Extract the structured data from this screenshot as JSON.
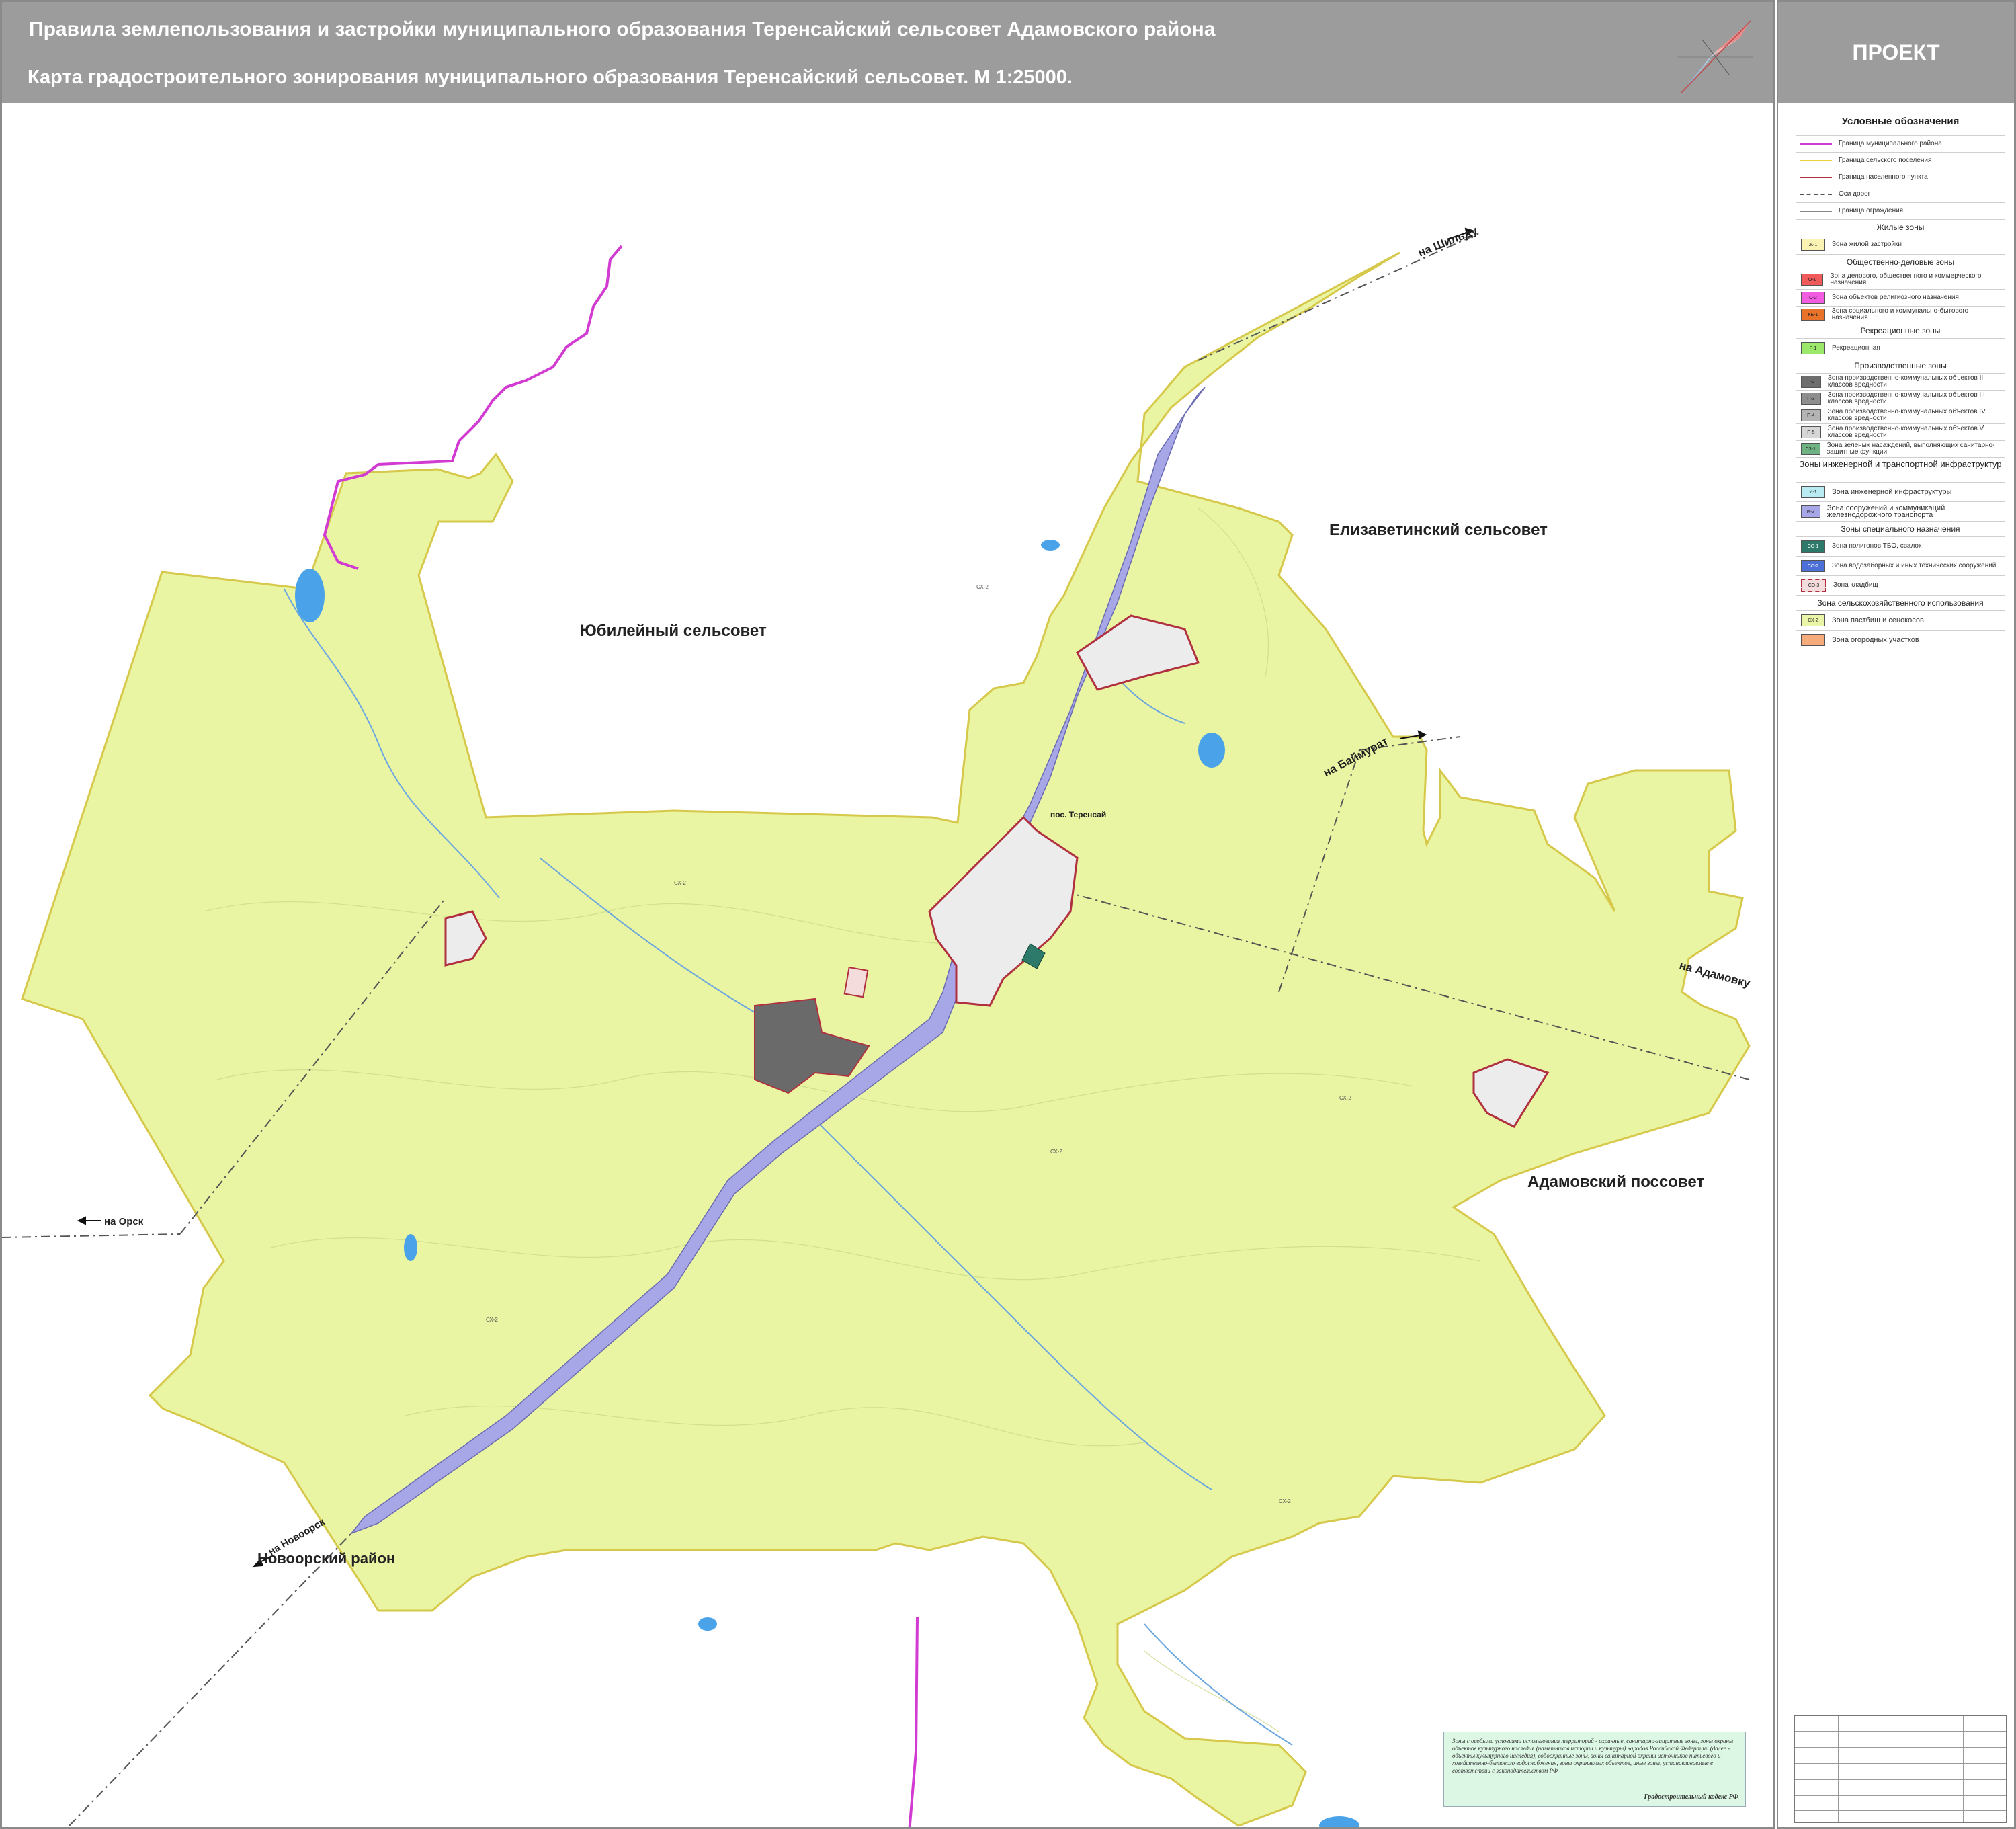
{
  "header": {
    "title_line1": "Правила землепользования и застройки муниципального образования Теренсайский сельсовет Адамовского района",
    "title_line2": "Карта градостроительного зонирования муниципального образования  Теренсайский сельсовет. М 1:25000.",
    "status": "ПРОЕКТ"
  },
  "map": {
    "neighbors": {
      "yubileyny": "Юбилейный сельсовет",
      "elizavetinsky": "Елизаветинский сельсовет",
      "adamovsky": "Адамовский поссовет",
      "novoorsky": "Новоорский район"
    },
    "roads": {
      "to_shildy": "на Шильду",
      "to_baimurat": "на Баймурат",
      "to_adamovka": "на Адамовку",
      "to_orsk": "на Орск",
      "to_novoorsk": "на Новоорск"
    },
    "settlement": "пос. Теренсай",
    "zone_label": "СХ-2"
  },
  "legend": {
    "title": "Условные обозначения",
    "lines": [
      {
        "label": "Граница муниципального района",
        "color": "#d23bd2"
      },
      {
        "label": "Граница сельского поселения",
        "color": "#e8d23a"
      },
      {
        "label": "Граница населенного пункта",
        "color": "#b03040"
      },
      {
        "label": "Оси дорог",
        "color": "#555555"
      },
      {
        "label": "Граница ограждения",
        "color": "#888888"
      }
    ],
    "sections": {
      "residential": "Жилые зоны",
      "public": "Общественно-деловые зоны",
      "recreation": "Рекреационные зоны",
      "production": "Производственные зоны",
      "infrastructure": "Зоны инженерной и транспортной инфраструктур",
      "special": "Зоны специального  назначения",
      "agri": "Зона сельскохозяйственного использования"
    },
    "residential": [
      {
        "code": "Ж-1",
        "label": "Зона жилой застройки",
        "color": "#fbf3b4"
      }
    ],
    "public": [
      {
        "code": "О-1",
        "label": "Зона делового, общественного и коммерческого назначения",
        "color": "#f05a5a"
      },
      {
        "code": "О-2",
        "label": "Зона объектов религиозного назначения",
        "color": "#f25ce0"
      },
      {
        "code": "КБ-1",
        "label": "Зона социального и коммунально-бытового назначения",
        "color": "#e8722a"
      }
    ],
    "recreation": [
      {
        "code": "Р-1",
        "label": "Рекреационная",
        "color": "#9be86a"
      }
    ],
    "production": [
      {
        "code": "П-2",
        "label": "Зона производственно-коммунальных объектов II классов вредности",
        "color": "#6e6e6e"
      },
      {
        "code": "П-3",
        "label": "Зона производственно-коммунальных объектов III классов вредности",
        "color": "#8e8e8e"
      },
      {
        "code": "П-4",
        "label": "Зона производственно-коммунальных объектов IV классов вредности",
        "color": "#b4b4b4"
      },
      {
        "code": "П-5",
        "label": "Зона производственно-коммунальных объектов V классов вредности",
        "color": "#d6d6d6"
      },
      {
        "code": "СЗ-1",
        "label": "Зона зеленых насаждений, выполняющих санитарно-защитные функции",
        "color": "#6fb384"
      }
    ],
    "infrastructure": [
      {
        "code": "И-1",
        "label": "Зона инженерной инфраструктуры",
        "color": "#b8ecf2"
      },
      {
        "code": "И-2",
        "label": "Зона сооружений и коммуникаций железнодорожного транспорта",
        "color": "#a7a7e8"
      }
    ],
    "special": [
      {
        "code": "СО-1",
        "label": "Зона полигонов ТБО, свалок",
        "color": "#2d7a6b"
      },
      {
        "code": "СО-2",
        "label": "Зона водозаборных и иных технических сооружений",
        "color": "#4c6fd8"
      },
      {
        "code": "СО-3",
        "label": "Зона кладбищ",
        "color": "#f4dcdc"
      }
    ],
    "agri": [
      {
        "code": "СХ-2",
        "label": "Зона  пастбищ и сенокосов",
        "color": "#eaf5a8"
      },
      {
        "code": "",
        "label": "Зона огородных  участков",
        "color": "#f6ab7a"
      }
    ]
  },
  "note": {
    "text": "Зоны с особыми условиями использования территорий - охранные, санитарно-защитные зоны, зоны охраны объектов культурного наследия (памятников истории и культуры) народов Российской Федерации (далее - объекты культурного наследия), водоохранные зоны, зоны санитарной охраны источников питьевого и хозяйственно-бытового водоснабжения, зоны охраняемых объектов, иные зоны, устанавливаемые в соответствии с законодательством РФ",
    "source": "Градостроительный кодекс РФ"
  },
  "colors": {
    "header_bg": "#9c9c9c",
    "land": "#e9f5a2",
    "district_border": "#d23bd2",
    "settlement_border": "#b03040",
    "railway": "#a7a7e8",
    "water": "#4aa3e8"
  }
}
